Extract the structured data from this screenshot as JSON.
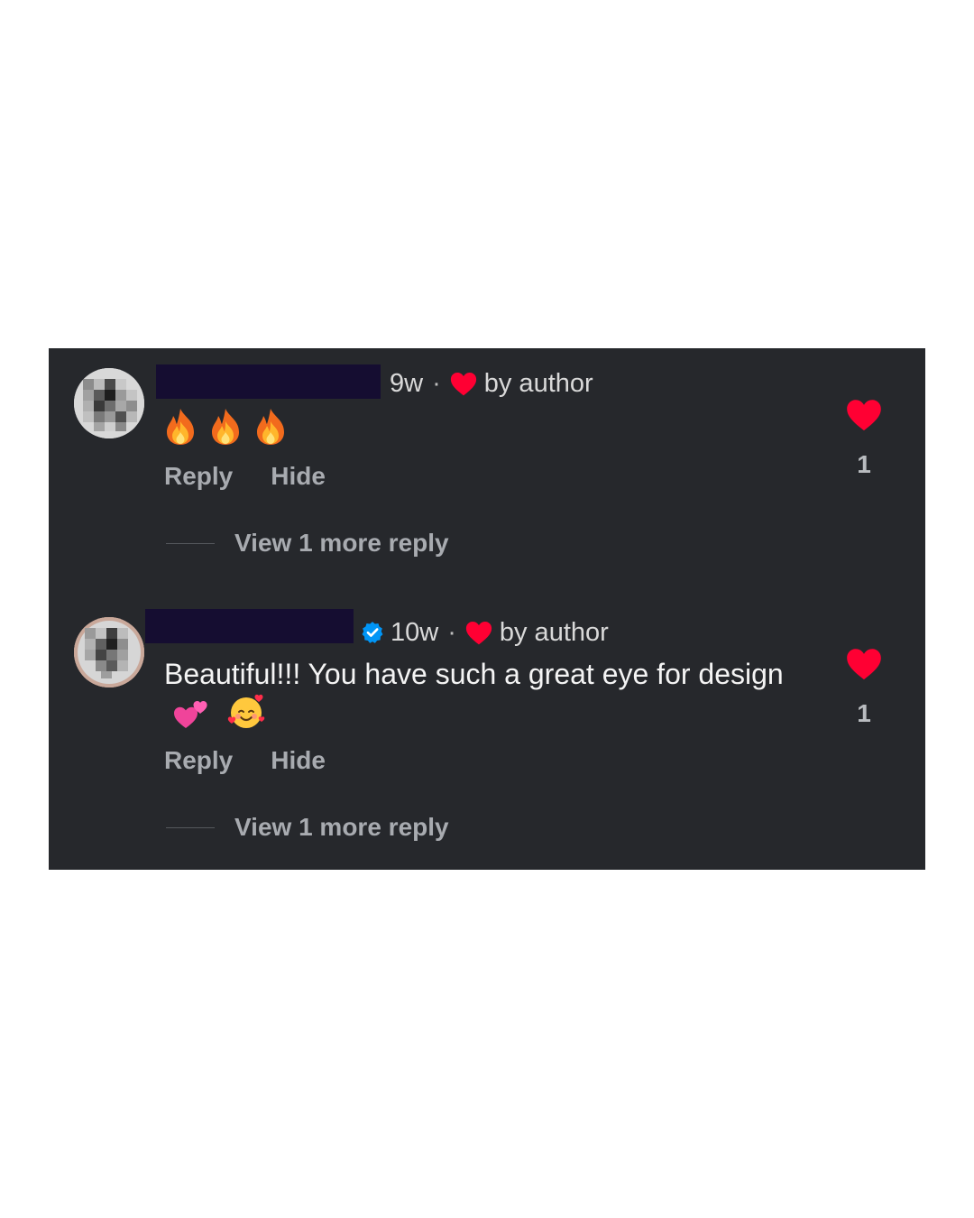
{
  "comments": [
    {
      "time": "9w",
      "separator": "·",
      "liked_by_author": "by author",
      "text": "",
      "emojis": [
        "fire-emoji",
        "fire-emoji",
        "fire-emoji"
      ],
      "actions": {
        "reply": "Reply",
        "hide": "Hide"
      },
      "view_more": "View 1 more reply",
      "like_count": "1",
      "verified": false
    },
    {
      "time": "10w",
      "separator": "·",
      "liked_by_author": "by author",
      "text": "Beautiful!!! You have such a great eye for design",
      "emojis": [
        "two-hearts-emoji",
        "smiling-face-with-hearts-emoji"
      ],
      "actions": {
        "reply": "Reply",
        "hide": "Hide"
      },
      "view_more": "View 1 more reply",
      "like_count": "1",
      "verified": true
    }
  ],
  "colors": {
    "card_bg": "#26282c",
    "heart": "#ff0033",
    "redaction": "#150d31",
    "verified": "#0095f6",
    "muted_text": "#a8abb0"
  }
}
